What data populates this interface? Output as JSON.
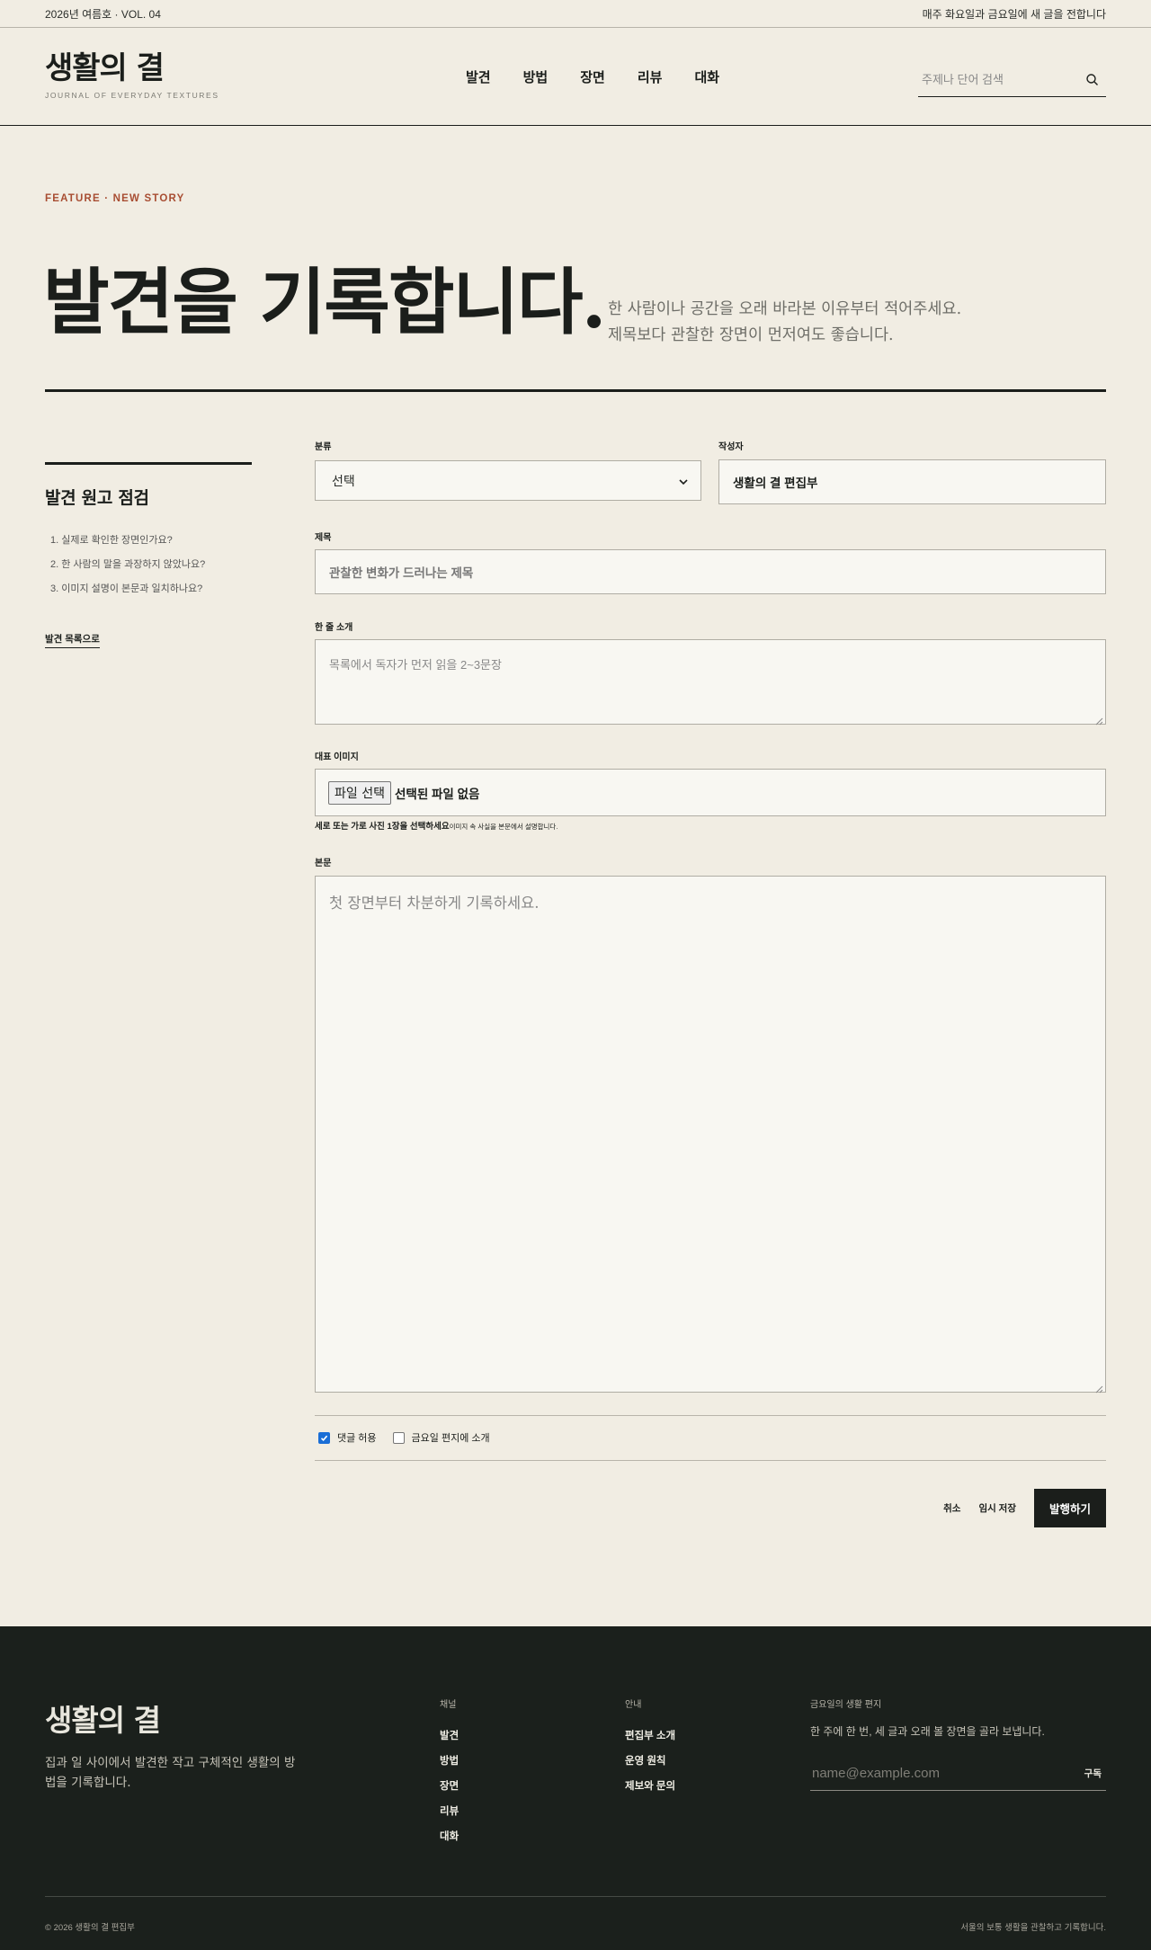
{
  "topbar": {
    "issue": "2026년 여름호 · VOL. 04",
    "schedule": "매주 화요일과 금요일에 새 글을 전합니다"
  },
  "header": {
    "brand": "생활의 결",
    "brand_sub": "JOURNAL OF EVERYDAY TEXTURES",
    "nav": [
      "발견",
      "방법",
      "장면",
      "리뷰",
      "대화"
    ],
    "search_placeholder": "주제나 단어 검색",
    "search_icon": "search-icon"
  },
  "hero": {
    "kicker": "FEATURE · NEW STORY",
    "title": "발견을 기록합니다.",
    "desc_line1": "한 사람이나 공간을 오래 바라본 이유부터 적어주세요.",
    "desc_line2": "제목보다 관찰한 장면이 먼저여도 좋습니다."
  },
  "sidebar": {
    "title": "발견 원고 점검",
    "checklist": [
      "1. 실제로 확인한 장면인가요?",
      "2. 한 사람의 말을 과장하지 않았나요?",
      "3. 이미지 설명이 본문과 일치하나요?"
    ],
    "link": "발견 목록으로"
  },
  "form": {
    "category_label": "분류",
    "category_value": "선택",
    "author_label": "작성자",
    "author_value": "생활의 결 편집부",
    "title_label": "제목",
    "title_placeholder": "관찰한 변화가 드러나는 제목",
    "summary_label": "한 줄 소개",
    "summary_placeholder": "목록에서 독자가 먼저 읽을 2~3문장",
    "image_label": "대표 이미지",
    "file_button": "파일 선택",
    "file_status": "선택된 파일 없음",
    "image_hint_bold": "세로 또는 가로 사진 1장을 선택하세요",
    "image_hint_small": "이미지 속 사실을 본문에서 설명합니다.",
    "body_label": "본문",
    "body_placeholder": "첫 장면부터 차분하게 기록하세요.",
    "allow_comments": "댓글 허용",
    "allow_comments_checked": true,
    "friday_letter": "금요일 편지에 소개",
    "friday_letter_checked": false,
    "cancel": "취소",
    "save_draft": "임시 저장",
    "publish": "발행하기"
  },
  "footer": {
    "brand": "생활의 결",
    "desc": "집과 일 사이에서 발견한 작고 구체적인 생활의 방법을 기록합니다.",
    "channels_title": "채널",
    "channels": [
      "발견",
      "방법",
      "장면",
      "리뷰",
      "대화"
    ],
    "guide_title": "안내",
    "guide": [
      "편집부 소개",
      "운영 원칙",
      "제보와 문의"
    ],
    "newsletter_title": "금요일의 생활 편지",
    "newsletter_desc": "한 주에 한 번, 세 글과 오래 볼 장면을 골라 보냅니다.",
    "email_placeholder": "name@example.com",
    "subscribe": "구독",
    "copyright": "© 2026 생활의 결 편집부",
    "tagline": "서울의 보통 생활을 관찰하고 기록합니다."
  },
  "colors": {
    "background": "#f1ede3",
    "ink": "#1b1e1b",
    "accent": "#a84d32",
    "footer_bg": "#1b201c",
    "checkbox_checked": "#1a6ed6"
  }
}
